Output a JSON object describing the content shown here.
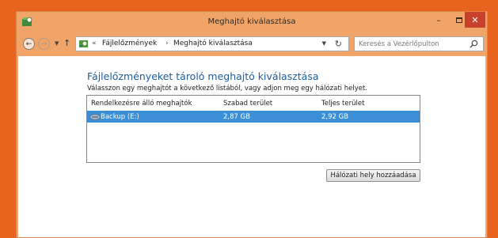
{
  "window": {
    "title": "Meghajtó kiválasztása",
    "accent_color": "#f0a467",
    "desktop_color": "#e8631e",
    "close_color": "#c7412d"
  },
  "address": {
    "separator": "«",
    "crumbs": [
      "Fájlelőzmények",
      "Meghajtó kiválasztása"
    ],
    "arrow": "›"
  },
  "search": {
    "placeholder": "Keresés a Vezérlőpulton"
  },
  "main": {
    "heading": "Fájlelőzményeket tároló meghajtó kiválasztása",
    "instruction": "Válasszon egy meghajtót a következő listából, vagy adjon meg egy hálózati helyet.",
    "columns": [
      "Rendelkezésre álló meghajtók",
      "Szabad terület",
      "Teljes terület"
    ],
    "rows": [
      {
        "name": "Backup (E:)",
        "free": "2,87 GB",
        "total": "2,92 GB",
        "selected": true,
        "icon": "drive-icon"
      }
    ],
    "selection_color": "#3b8fd6",
    "heading_color": "#1c5d9c",
    "add_network_label": "Hálózati hely hozzáadása"
  }
}
